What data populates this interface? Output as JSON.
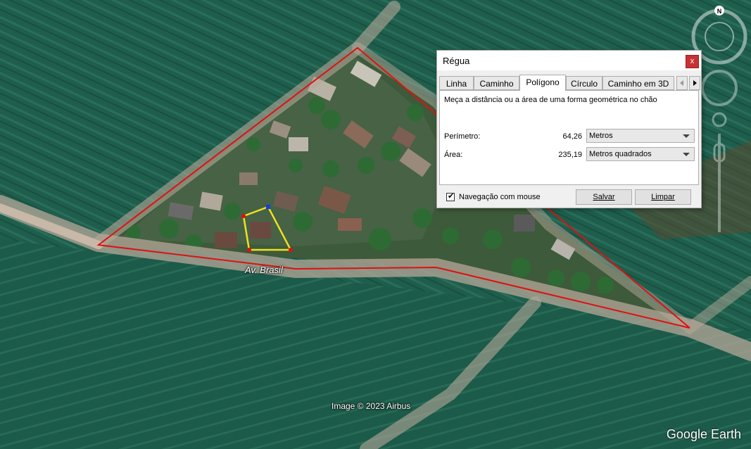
{
  "map": {
    "road_label": "Av. Brasil",
    "attribution": "Image © 2023 Airbus",
    "logo": "Google Earth",
    "compass_letter": "N",
    "colors": {
      "polygon_large": "#e01010",
      "polygon_small": "#f0e020",
      "vertex": "#e01010",
      "vertex_active": "#1040e0"
    }
  },
  "dialog": {
    "title": "Régua",
    "close_label": "x",
    "tabs": [
      "Linha",
      "Caminho",
      "Polígono",
      "Círculo",
      "Caminho em 3D"
    ],
    "active_tab": "Polígono",
    "description": "Meça a distância ou a área de uma forma geométrica no chão",
    "perimeter": {
      "label": "Perímetro:",
      "value": "64,26",
      "unit": "Metros"
    },
    "area": {
      "label": "Área:",
      "value": "235,19",
      "unit": "Metros quadrados"
    },
    "mouse_nav": {
      "label": "Navegação com mouse",
      "checked": true
    },
    "save_label": "Salvar",
    "clear_label": "Limpar"
  }
}
